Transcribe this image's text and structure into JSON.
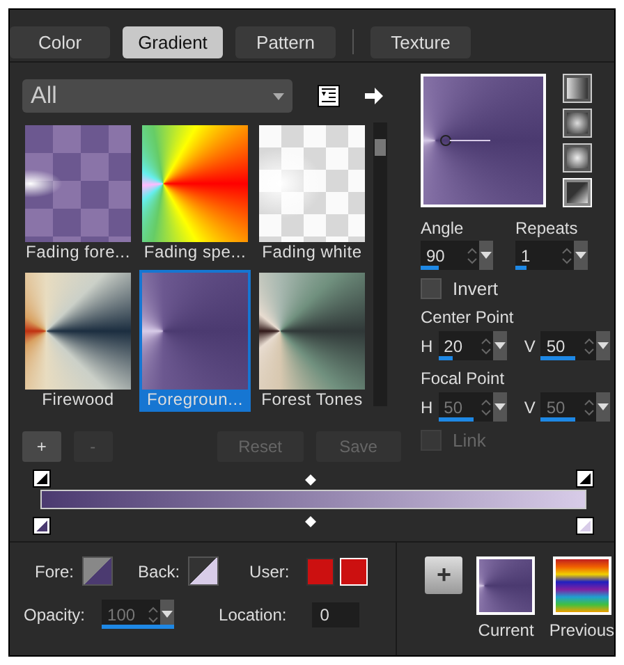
{
  "tabs": [
    {
      "label": "Color",
      "selected": false
    },
    {
      "label": "Gradient",
      "selected": true
    },
    {
      "label": "Pattern",
      "selected": false
    },
    {
      "label": "Texture",
      "selected": false
    }
  ],
  "category": {
    "value": "All"
  },
  "presets": [
    {
      "label": "Fading fore...",
      "selected": false
    },
    {
      "label": "Fading spe...",
      "selected": false
    },
    {
      "label": "Fading white",
      "selected": false
    },
    {
      "label": "Firewood",
      "selected": false
    },
    {
      "label": "Foregroun...",
      "selected": true
    },
    {
      "label": "Forest Tones",
      "selected": false
    }
  ],
  "preset_buttons": [
    {
      "label": "+",
      "disabled": false
    },
    {
      "label": "-",
      "disabled": true
    },
    {
      "label": "Reset",
      "disabled": true
    },
    {
      "label": "Save",
      "disabled": true
    }
  ],
  "styles": [
    {
      "selected": false
    },
    {
      "selected": false
    },
    {
      "selected": false
    },
    {
      "selected": true
    }
  ],
  "angle": {
    "label": "Angle",
    "value": "90",
    "level": 0.25
  },
  "repeats": {
    "label": "Repeats",
    "value": "1",
    "level": 0.15
  },
  "invert": {
    "label": "Invert",
    "checked": false
  },
  "center_point": {
    "label": "Center Point",
    "h": {
      "label": "H",
      "value": "20",
      "level": 0.2,
      "disabled": false
    },
    "v": {
      "label": "V",
      "value": "50",
      "level": 0.5,
      "disabled": false
    }
  },
  "focal_point": {
    "label": "Focal Point",
    "h": {
      "label": "H",
      "value": "50",
      "level": 0.5,
      "disabled": true
    },
    "v": {
      "label": "V",
      "value": "50",
      "level": 0.5,
      "disabled": true
    }
  },
  "link": {
    "label": "Link",
    "checked": false,
    "disabled": true
  },
  "fore": {
    "label": "Fore:"
  },
  "back": {
    "label": "Back:"
  },
  "user": {
    "label": "User:"
  },
  "opacity": {
    "label": "Opacity:",
    "value": "100",
    "level": 1,
    "disabled": true
  },
  "location": {
    "label": "Location:",
    "value": "0"
  },
  "add_button": {
    "label": "+"
  },
  "current": {
    "label": "Current"
  },
  "previous": {
    "label": "Previous"
  }
}
